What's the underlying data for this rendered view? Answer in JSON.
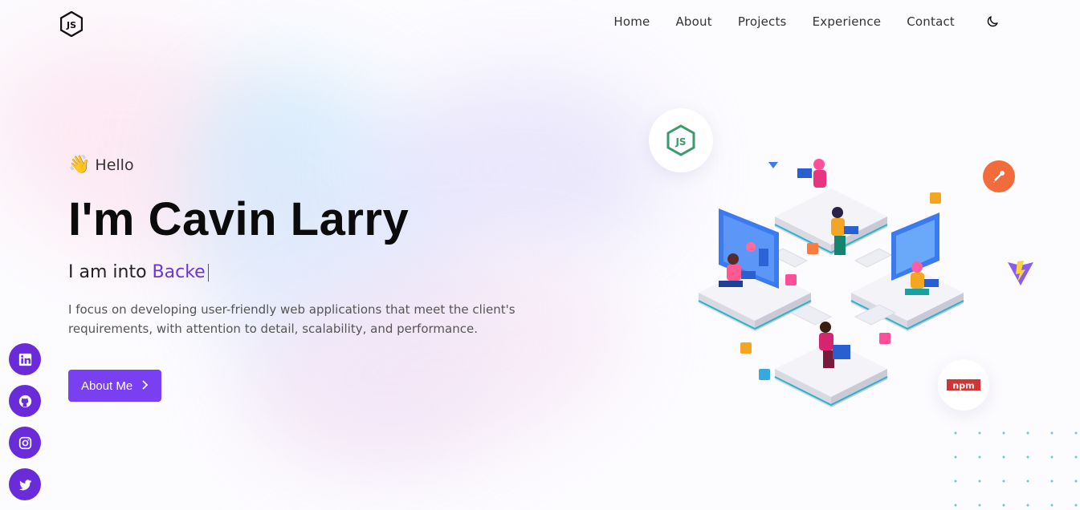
{
  "nav": {
    "items": [
      "Home",
      "About",
      "Projects",
      "Experience",
      "Contact"
    ],
    "theme_toggle_icon": "moon-icon"
  },
  "hero": {
    "greeting": "Hello",
    "greeting_icon": "waving-hand-icon",
    "heading": "I'm Cavin Larry",
    "role_prefix": "I am into",
    "role_typed": "Backe",
    "description": "I focus on developing user-friendly web applications that meet the client's requirements, with attention to detail, scalability, and performance.",
    "cta_label": "About Me"
  },
  "socials": [
    "linkedin-icon",
    "github-icon",
    "instagram-icon",
    "twitter-icon"
  ],
  "illustration": {
    "badges": [
      "nodejs-icon",
      "postman-icon",
      "vite-icon",
      "npm-icon"
    ],
    "npm_text": "npm"
  },
  "colors": {
    "accent": "#7b3ff2",
    "social_bg": "#6a2bd9",
    "node_green": "#3c9a6b"
  }
}
